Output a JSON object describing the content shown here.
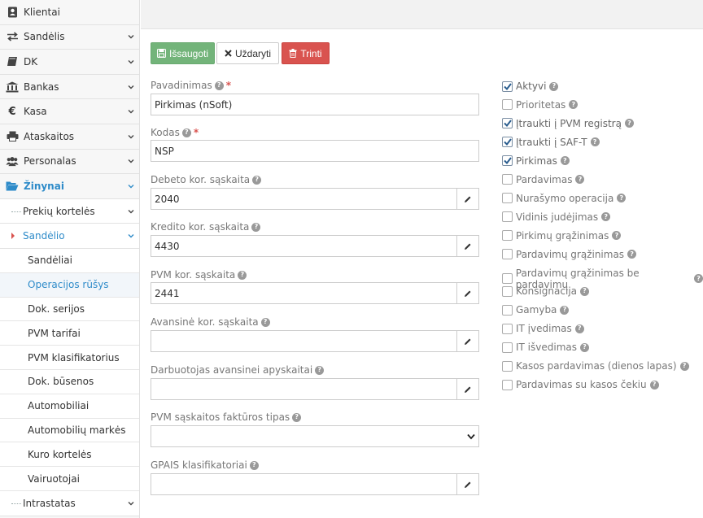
{
  "sidebar": {
    "items": [
      {
        "label": "Klientai",
        "icon": "address-book-icon"
      },
      {
        "label": "Sandėlis",
        "icon": "exchange-icon"
      },
      {
        "label": "DK",
        "icon": "book-icon"
      },
      {
        "label": "Bankas",
        "icon": "bank-icon"
      },
      {
        "label": "Kasa",
        "icon": "euro-icon"
      },
      {
        "label": "Ataskaitos",
        "icon": "printer-icon"
      },
      {
        "label": "Personalas",
        "icon": "users-icon"
      },
      {
        "label": "Žinynai",
        "icon": "folder-open-icon"
      }
    ],
    "subitems": [
      {
        "label": "Prekių kortelės"
      },
      {
        "label": "Sandėlio"
      }
    ],
    "subsubitems": [
      {
        "label": "Sandėliai"
      },
      {
        "label": "Operacijos rūšys"
      },
      {
        "label": "Dok. serijos"
      },
      {
        "label": "PVM tarifai"
      },
      {
        "label": "PVM klasifikatorius"
      },
      {
        "label": "Dok. būsenos"
      },
      {
        "label": "Automobiliai"
      },
      {
        "label": "Automobilių markės"
      },
      {
        "label": "Kuro kortelės"
      },
      {
        "label": "Vairuotojai"
      }
    ],
    "bottom_item": {
      "label": "Intrastatas"
    }
  },
  "toolbar": {
    "save_label": "Išsaugoti",
    "close_label": "Uždaryti",
    "delete_label": "Trinti"
  },
  "form": {
    "name": {
      "label": "Pavadinimas",
      "value": "Pirkimas (nSoft)"
    },
    "code": {
      "label": "Kodas",
      "value": "NSP"
    },
    "debit": {
      "label": "Debeto kor. sąskaita",
      "value": "2040"
    },
    "credit": {
      "label": "Kredito kor. sąskaita",
      "value": "4430"
    },
    "vat": {
      "label": "PVM kor. sąskaita",
      "value": "2441"
    },
    "advance": {
      "label": "Avansinė kor. sąskaita",
      "value": ""
    },
    "employee": {
      "label": "Darbuotojas avansinei apyskaitai",
      "value": ""
    },
    "invoice_type": {
      "label": "PVM sąskaitos faktūros tipas",
      "value": ""
    },
    "gpais": {
      "label": "GPAIS klasifikatoriai",
      "value": ""
    }
  },
  "flags": [
    {
      "label": "Aktyvi",
      "checked": true
    },
    {
      "label": "Prioritetas",
      "checked": false
    },
    {
      "label": "Įtraukti į PVM registrą",
      "checked": true
    },
    {
      "label": "Įtraukti į SAF-T",
      "checked": true
    },
    {
      "label": "Pirkimas",
      "checked": true
    },
    {
      "label": "Pardavimas",
      "checked": false
    },
    {
      "label": "Nurašymo operacija",
      "checked": false
    },
    {
      "label": "Vidinis judėjimas",
      "checked": false
    },
    {
      "label": "Pirkimų grąžinimas",
      "checked": false
    },
    {
      "label": "Pardavimų grąžinimas",
      "checked": false
    },
    {
      "label": "Pardavimų grąžinimas be pardavimų",
      "checked": false
    },
    {
      "label": "Konsignacija",
      "checked": false
    },
    {
      "label": "Gamyba",
      "checked": false
    },
    {
      "label": "IT įvedimas",
      "checked": false
    },
    {
      "label": "IT išvedimas",
      "checked": false
    },
    {
      "label": "Kasos pardavimas (dienos lapas)",
      "checked": false
    },
    {
      "label": "Pardavimas su kasos čekiu",
      "checked": false
    }
  ],
  "colors": {
    "accent": "#2e8bc9",
    "save": "#73b47a",
    "delete": "#d9534f"
  }
}
